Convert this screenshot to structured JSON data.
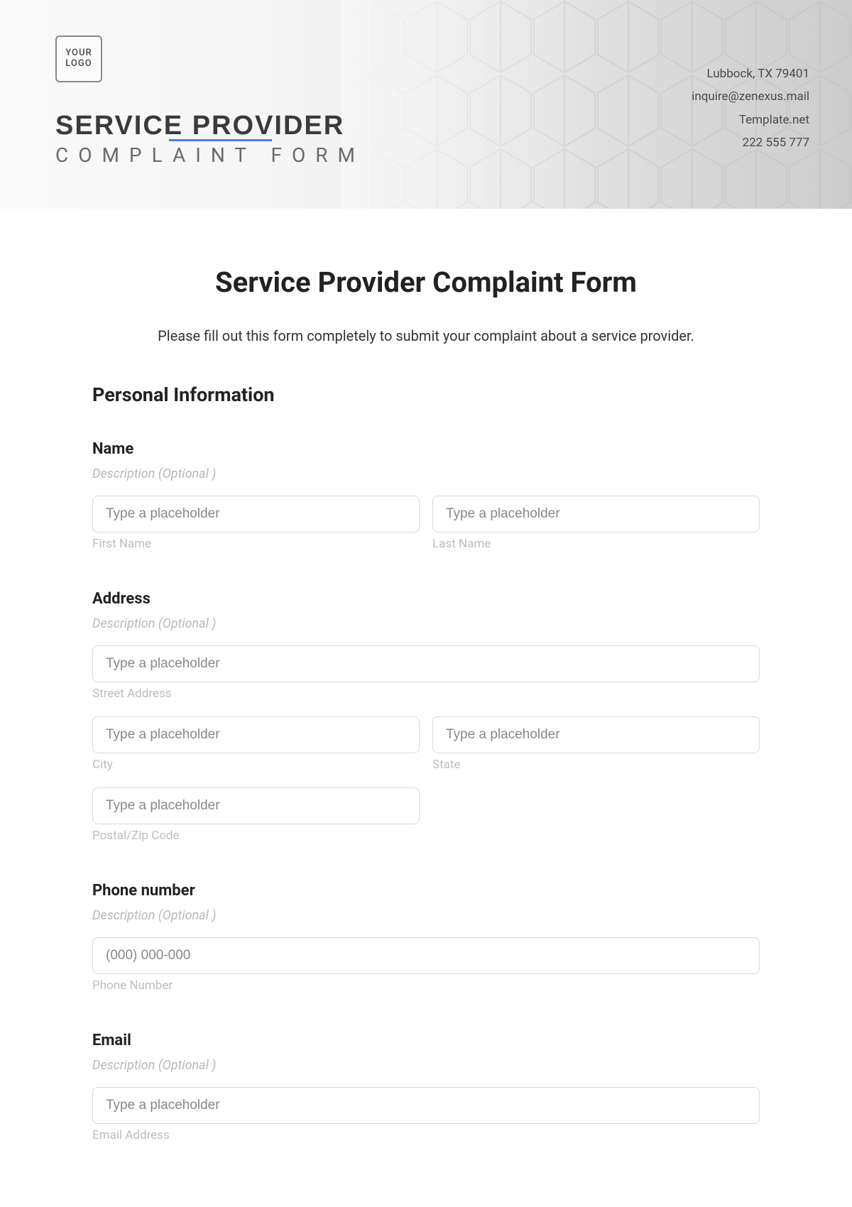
{
  "hero": {
    "logo_text": "YOUR\nLOGO",
    "title_line1": "SERVICE PROVIDER",
    "title_line2": "COMPLAINT FORM",
    "contact": {
      "address": "Lubbock, TX 79401",
      "email": "inquire@zenexus.mail",
      "site": "Template.net",
      "phone": "222 555 777"
    }
  },
  "page": {
    "title": "Service Provider Complaint Form",
    "intro": "Please fill out this form completely to submit your complaint about a service provider."
  },
  "section_personal": "Personal Information",
  "name_group": {
    "label": "Name",
    "desc": "Description (Optional )",
    "first_placeholder": "Type a placeholder",
    "first_sub": "First Name",
    "last_placeholder": "Type a placeholder",
    "last_sub": "Last Name"
  },
  "address_group": {
    "label": "Address",
    "desc": "Description (Optional )",
    "street_placeholder": "Type a placeholder",
    "street_sub": "Street Address",
    "city_placeholder": "Type a placeholder",
    "city_sub": "City",
    "state_placeholder": "Type a placeholder",
    "state_sub": "State",
    "zip_placeholder": "Type a placeholder",
    "zip_sub": "Postal/Zip Code"
  },
  "phone_group": {
    "label": "Phone number",
    "desc": "Description (Optional )",
    "placeholder": "(000) 000-000",
    "sub": "Phone Number"
  },
  "email_group": {
    "label": "Email",
    "desc": "Description (Optional )",
    "placeholder": "Type a placeholder",
    "sub": "Email Address"
  }
}
